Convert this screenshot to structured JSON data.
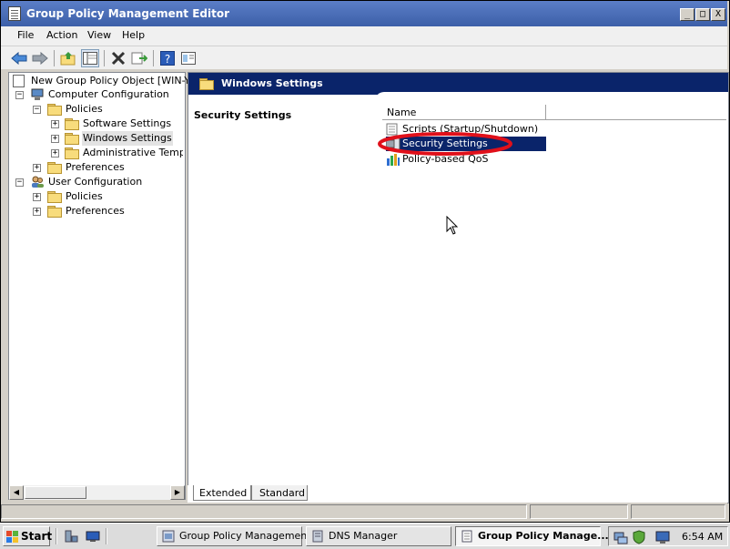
{
  "window": {
    "title": "Group Policy Management Editor",
    "controls": {
      "minimize": "_",
      "maximize": "□",
      "close": "X"
    }
  },
  "menu": [
    "File",
    "Action",
    "View",
    "Help"
  ],
  "toolbar": {
    "icons": [
      "back-arrow-icon",
      "forward-arrow-icon",
      "up-folder-icon",
      "show-hide-tree-icon",
      "delete-icon",
      "export-list-icon",
      "help-icon",
      "properties-icon"
    ]
  },
  "tree": {
    "root": "New Group Policy Object [WIN-YYH",
    "computer_config": "Computer Configuration",
    "cc_policies": "Policies",
    "software_settings": "Software Settings",
    "windows_settings": "Windows Settings",
    "admin_templates": "Administrative Templat",
    "cc_preferences": "Preferences",
    "user_config": "User Configuration",
    "uc_policies": "Policies",
    "uc_preferences": "Preferences"
  },
  "right": {
    "header": "Windows Settings",
    "description_title": "Security Settings",
    "list_column": "Name",
    "items": [
      {
        "label": "Scripts (Startup/Shutdown)"
      },
      {
        "label": "Security Settings"
      },
      {
        "label": "Policy-based QoS"
      }
    ]
  },
  "tabs": [
    "Extended",
    "Standard"
  ],
  "taskbar": {
    "start": "Start",
    "buttons": [
      "Group Policy Management",
      "DNS Manager",
      "Group Policy Manage..."
    ],
    "clock": "6:54 AM"
  },
  "colors": {
    "accent": "#0a246a",
    "selection": "#0a246a",
    "highlight_ring": "#e0101a"
  }
}
